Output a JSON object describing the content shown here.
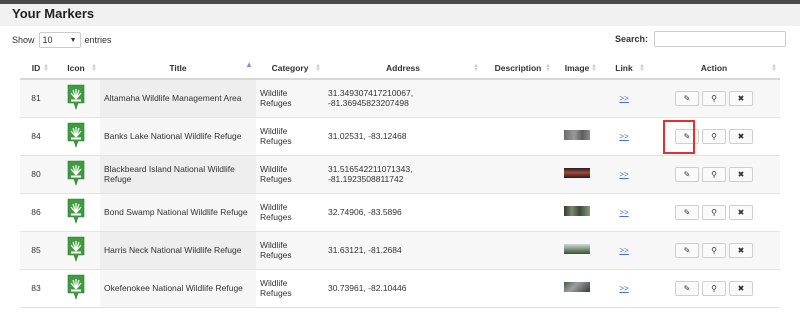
{
  "page": {
    "title": "Your Markers"
  },
  "controls": {
    "show_label": "Show",
    "entries_value": "10",
    "entries_label": "entries",
    "search_label": "Search:",
    "search_value": ""
  },
  "columns": [
    "ID",
    "Icon",
    "Title",
    "Category",
    "Address",
    "Description",
    "Image",
    "Link",
    "Action"
  ],
  "rows": [
    {
      "id": "81",
      "title": "Altamaha Wildlife Management Area",
      "category": "Wildlife Refuges",
      "address": "31.349307417210067, -81.36945823207498",
      "description": "",
      "image": "",
      "link": ">>"
    },
    {
      "id": "84",
      "title": "Banks Lake National Wildlife Refuge",
      "category": "Wildlife Refuges",
      "address": "31.02531, -83.12468",
      "description": "",
      "image": "thumb-lake",
      "link": ">>"
    },
    {
      "id": "80",
      "title": "Blackbeard Island National Wildlife Refuge",
      "category": "Wildlife Refuges",
      "address": "31.516542211071343, -81.1923508811742",
      "description": "",
      "image": "thumb-sunset",
      "link": ">>"
    },
    {
      "id": "86",
      "title": "Bond Swamp National Wildlife Refuge",
      "category": "Wildlife Refuges",
      "address": "32.74906, -83.5896",
      "description": "",
      "image": "thumb-forest",
      "link": ">>"
    },
    {
      "id": "85",
      "title": "Harris Neck National Wildlife Refuge",
      "category": "Wildlife Refuges",
      "address": "31.63121, -81.2684",
      "description": "",
      "image": "thumb-coast",
      "link": ">>"
    },
    {
      "id": "83",
      "title": "Okefenokee National Wildlife Refuge",
      "category": "Wildlife Refuges",
      "address": "30.73961, -82.10446",
      "description": "",
      "image": "thumb-swamp",
      "link": ">>"
    }
  ],
  "actions": {
    "edit": "edit-icon",
    "locate": "map-pin-icon",
    "delete": "delete-icon"
  },
  "colors": {
    "marker_green": "#3f9b3f",
    "link_blue": "#4a6fd0",
    "highlight_red": "#d33333"
  }
}
